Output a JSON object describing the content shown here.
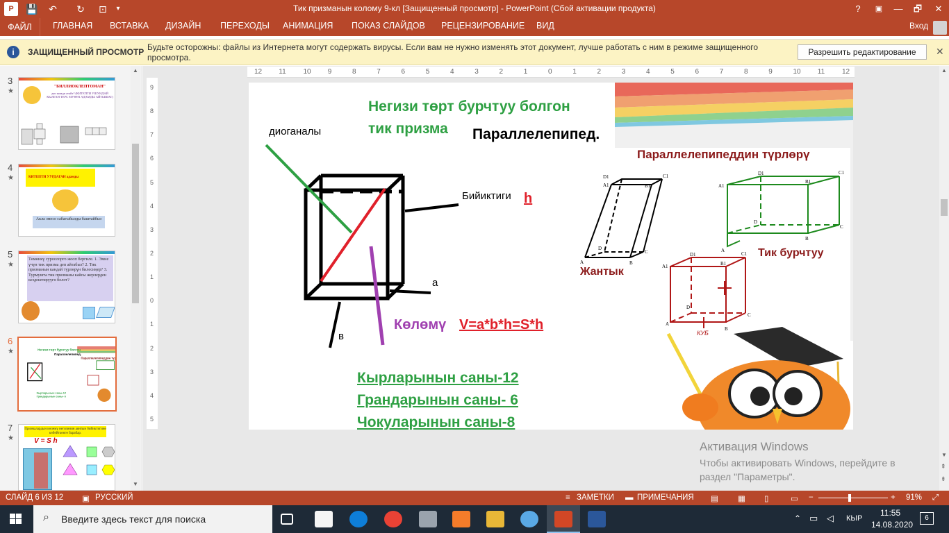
{
  "window": {
    "title": "Тик призманын колому 9-кл [Защищенный просмотр] - PowerPoint (Сбой активации продукта)",
    "help": "?",
    "minimize": "—",
    "restore": "🗗",
    "close": "✕"
  },
  "quick_access": {
    "save": "💾",
    "undo": "↶",
    "redo": "↻"
  },
  "ribbon": {
    "file": "ФАЙЛ",
    "tabs": [
      "ГЛАВНАЯ",
      "ВСТАВКА",
      "ДИЗАЙН",
      "ПЕРЕХОДЫ",
      "АНИМАЦИЯ",
      "ПОКАЗ СЛАЙДОВ",
      "РЕЦЕНЗИРОВАНИЕ",
      "ВИД"
    ],
    "signin": "Вход"
  },
  "protected_bar": {
    "title": "ЗАЩИЩЕННЫЙ ПРОСМОТР",
    "message": "Будьте осторожны: файлы из Интернета могут содержать вирусы. Если вам не нужно изменять этот документ, лучше работать с ним в режиме защищенного просмотра.",
    "button": "Разрешить редактирование",
    "close": "✕"
  },
  "thumbnails": [
    {
      "number": "3",
      "star": "★",
      "title": "\"БИЛЛИОКЛЕПТОМАН\"",
      "text": "деп кимди атайт? (КИТЕПТИ УШУНДАЙ КЫЛГАН ТЕРС МУНӨЗ АДАМДЫ АЙТЫШАТ)"
    },
    {
      "number": "4",
      "star": "★",
      "title": "КИТЕПТИ УУРДАГАН адамды",
      "text": "Акла эмесе сабагыбызды баштайбыз"
    },
    {
      "number": "5",
      "star": "★",
      "text": "Төмөнкү суроолорго жооп бергиле. 1. Эмне үчүн тик призма деп айтабыз? 2. Тик призманын кандай түрлөрүн билесиңер? 3. Турмушта тик призманы кайсы жерлерден кездештирүүгө болот?"
    },
    {
      "number": "6",
      "star": "★",
      "selected": true
    },
    {
      "number": "7",
      "star": "★",
      "title": "Призмалардын көлөмү негизинин аянтын бийиктигине көбөйткөнгө барабар.",
      "formula": "V = S h"
    }
  ],
  "ruler": {
    "h_ticks": [
      "12",
      "11",
      "10",
      "9",
      "8",
      "7",
      "6",
      "5",
      "4",
      "3",
      "2",
      "1",
      "0",
      "1",
      "2",
      "3",
      "4",
      "5",
      "6",
      "7",
      "8",
      "9",
      "10",
      "11",
      "12"
    ],
    "v_ticks": [
      "9",
      "8",
      "7",
      "6",
      "5",
      "4",
      "3",
      "2",
      "1",
      "0",
      "1",
      "2",
      "3",
      "4",
      "5"
    ]
  },
  "slide": {
    "heading_line1": "Негизи төрт бурчтуу болгон",
    "heading_line2": "тик призма",
    "parallelepiped": "Параллелепипед.",
    "diagonal_label": "диоганалы",
    "height_label": "Бийиктиги",
    "h": "h",
    "a": "а",
    "b": "в",
    "volume_label": "Көлөмү",
    "volume_formula": "V=a*b*h=S*h",
    "edges": "Кырларынын саны-12",
    "faces": "Грандарынын саны- 6",
    "vertices": "Чокуларынын саны-8",
    "types_title": "Параллелепипеддин түрлөрү",
    "oblique": "Жантык",
    "right": "Тик бурчтуу",
    "cube": "КУБ",
    "vertex_labels": [
      "A1",
      "B1",
      "C1",
      "D1",
      "A",
      "B",
      "C",
      "D"
    ]
  },
  "status": {
    "slide": "СЛАЙД 6 ИЗ 12",
    "language": "РУССКИЙ",
    "notes": "ЗАМЕТКИ",
    "comments": "ПРИМЕЧАНИЯ",
    "zoom": "91%"
  },
  "activation": {
    "title": "Активация Windows",
    "message": "Чтобы активировать Windows, перейдите в раздел \"Параметры\"."
  },
  "taskbar": {
    "search_placeholder": "Введите здесь текст для поиска",
    "lang": "КЫР",
    "time": "11:55",
    "date": "14.08.2020",
    "notif_count": "6"
  },
  "colors": {
    "accent": "#b7472a",
    "green": "#2ea043",
    "dark_red": "#8b1a1a",
    "purple": "#a040b0"
  }
}
